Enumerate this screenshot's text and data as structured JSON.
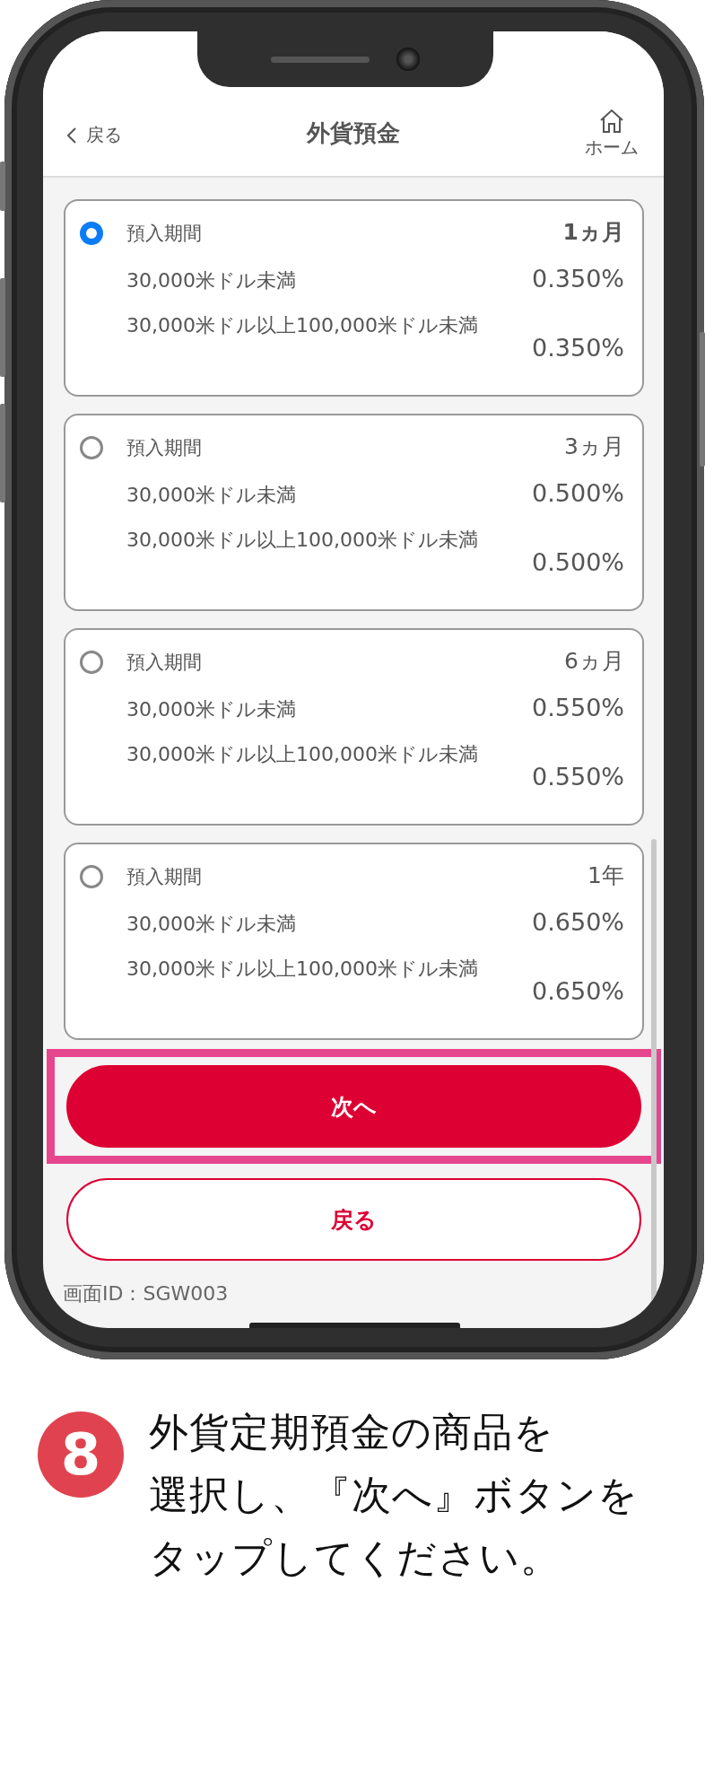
{
  "header": {
    "back": "戻る",
    "title": "外貨預金",
    "home": "ホーム"
  },
  "plans": [
    {
      "label": "預入期間",
      "term": "1ヵ月",
      "selected": true,
      "tiers": [
        {
          "kind": "inline",
          "condition": "30,000米ドル未満",
          "rate": "0.350%"
        },
        {
          "kind": "wrapped",
          "condition": "30,000米ドル以上100,000米ドル未満",
          "rate": "0.350%"
        }
      ]
    },
    {
      "label": "預入期間",
      "term": "3ヵ月",
      "selected": false,
      "tiers": [
        {
          "kind": "inline",
          "condition": "30,000米ドル未満",
          "rate": "0.500%"
        },
        {
          "kind": "wrapped",
          "condition": "30,000米ドル以上100,000米ドル未満",
          "rate": "0.500%"
        }
      ]
    },
    {
      "label": "預入期間",
      "term": "6ヵ月",
      "selected": false,
      "tiers": [
        {
          "kind": "inline",
          "condition": "30,000米ドル未満",
          "rate": "0.550%"
        },
        {
          "kind": "wrapped",
          "condition": "30,000米ドル以上100,000米ドル未満",
          "rate": "0.550%"
        }
      ]
    },
    {
      "label": "預入期間",
      "term": "1年",
      "selected": false,
      "tiers": [
        {
          "kind": "inline",
          "condition": "30,000米ドル未満",
          "rate": "0.650%"
        },
        {
          "kind": "wrapped",
          "condition": "30,000米ドル以上100,000米ドル未満",
          "rate": "0.650%"
        }
      ]
    }
  ],
  "buttons": [
    {
      "kind": "primary",
      "label": "次へ",
      "highlighted": true
    },
    {
      "kind": "secondary",
      "label": "戻る",
      "highlighted": false
    }
  ],
  "screen_id": "画面ID：SGW003",
  "step": {
    "number": "8",
    "lines": [
      "外貨定期預金の商品を",
      "選択し、『次へ』ボタンを",
      "タップしてください。"
    ]
  }
}
